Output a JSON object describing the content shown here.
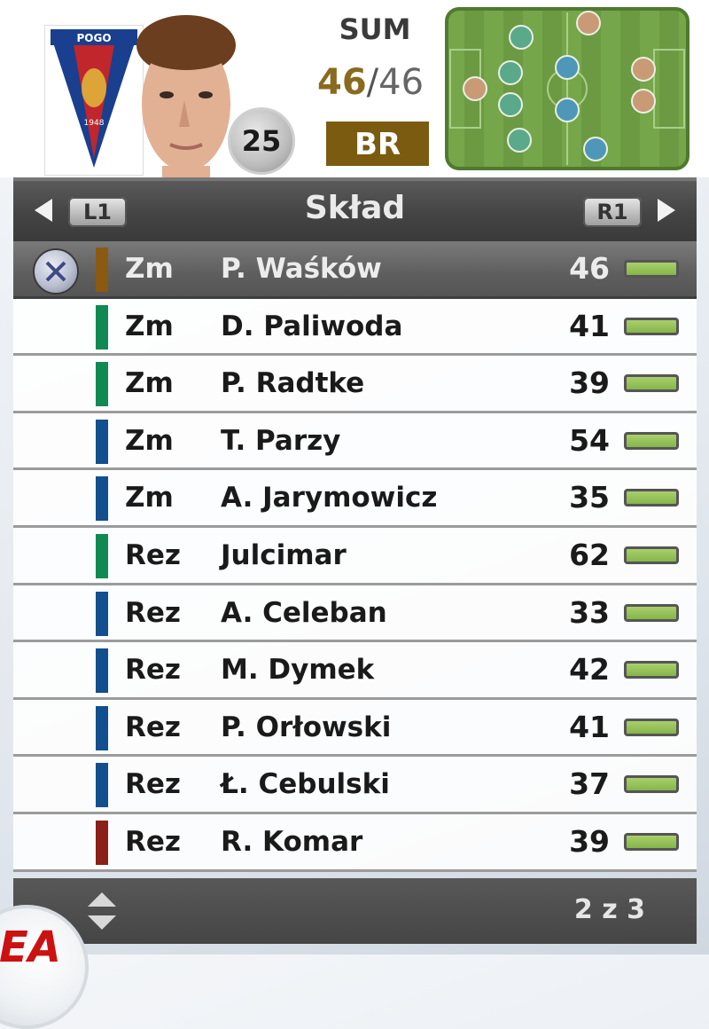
{
  "player": {
    "age": "25",
    "position_code": "BR",
    "sum_label": "SUM",
    "sum_current": "46",
    "sum_separator": "/",
    "sum_total": "46"
  },
  "crest": {
    "text": "POGO",
    "year": "1948"
  },
  "panel": {
    "title": "Skład",
    "left_shoulder": "L1",
    "right_shoulder": "R1"
  },
  "rows": [
    {
      "pos": "Zm",
      "name": "P. Waśków",
      "value": "46",
      "stripe": "#8a5a12",
      "selected": true
    },
    {
      "pos": "Zm",
      "name": "D. Paliwoda",
      "value": "41",
      "stripe": "#108a52"
    },
    {
      "pos": "Zm",
      "name": "P. Radtke",
      "value": "39",
      "stripe": "#108a52"
    },
    {
      "pos": "Zm",
      "name": "T. Parzy",
      "value": "54",
      "stripe": "#124f8f"
    },
    {
      "pos": "Zm",
      "name": "A. Jarymowicz",
      "value": "35",
      "stripe": "#124f8f"
    },
    {
      "pos": "Rez",
      "name": "Julcimar",
      "value": "62",
      "stripe": "#108a52"
    },
    {
      "pos": "Rez",
      "name": "A. Celeban",
      "value": "33",
      "stripe": "#124f8f"
    },
    {
      "pos": "Rez",
      "name": "M. Dymek",
      "value": "42",
      "stripe": "#124f8f"
    },
    {
      "pos": "Rez",
      "name": "P. Orłowski",
      "value": "41",
      "stripe": "#124f8f"
    },
    {
      "pos": "Rez",
      "name": "Ł. Cebulski",
      "value": "37",
      "stripe": "#124f8f"
    },
    {
      "pos": "Rez",
      "name": "R. Komar",
      "value": "39",
      "stripe": "#8a2018"
    }
  ],
  "footer": {
    "page": "2 z 3"
  },
  "logo": "EA",
  "colors": {
    "midfield": "#108a52",
    "defence": "#124f8f",
    "goalkeeper": "#8a5a12",
    "attack": "#8a2018",
    "bar_fill": "#92c155"
  },
  "icons": {
    "left": "triangle-left-icon",
    "right": "triangle-right-icon",
    "select": "cross-button-icon",
    "scroll": "up-down-arrows-icon"
  }
}
